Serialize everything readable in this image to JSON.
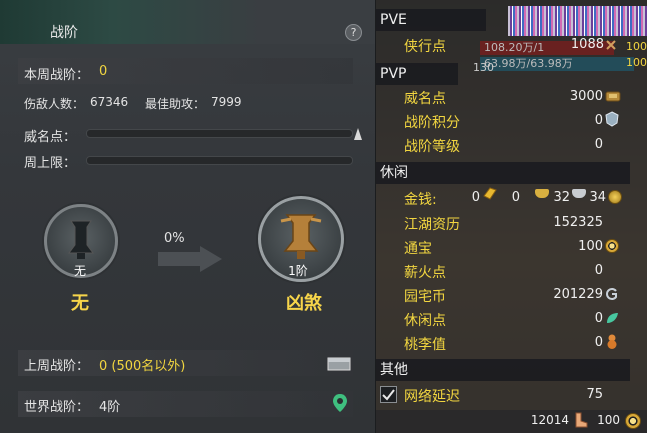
{
  "left": {
    "title": "战阶",
    "help": "?",
    "weekly_rank_label": "本周战阶：",
    "weekly_rank_value": "0",
    "kills_label": "伤敌人数：",
    "kills_value": "67346",
    "assist_label": "最佳助攻：",
    "assist_value": "7999",
    "prestige_label": "威名点：",
    "weekly_cap_label": "周上限：",
    "progress_percent": "0%",
    "current_medal_label": "无",
    "current_rank_name": "无",
    "next_medal_label": "1阶",
    "next_rank_name": "凶煞",
    "last_week_label": "上周战阶：",
    "last_week_value": "0 (500名以外)",
    "world_rank_label": "世界战阶：",
    "world_rank_value": "4阶"
  },
  "right": {
    "pve_header": "PVE",
    "chivalry_label": "侠行点",
    "chivalry_value": "1088",
    "hp_text": "108.20万/1",
    "mp_text": "63.98万/63.98万",
    "level_badge": "130",
    "edge_right_1": "100",
    "edge_right_2": "100",
    "pvp_header": "PVP",
    "prestige_label": "威名点",
    "prestige_value": "3000",
    "battle_points_label": "战阶积分",
    "battle_points_value": "0",
    "battle_level_label": "战阶等级",
    "battle_level_value": "0",
    "leisure_header": "休闲",
    "money_label": "金钱:",
    "money_gold": "0",
    "money_big": "0",
    "money_silver": "32",
    "money_copper": "34",
    "jianghu_label": "江湖资历",
    "jianghu_value": "152325",
    "tongbao_label": "通宝",
    "tongbao_value": "100",
    "firewood_label": "薪火点",
    "firewood_value": "0",
    "garden_label": "园宅币",
    "garden_value": "201229",
    "leisure_pts_label": "休闲点",
    "leisure_pts_value": "0",
    "taoli_label": "桃李值",
    "taoli_value": "0",
    "other_header": "其他",
    "latency_label": "网络延迟",
    "latency_value": "75",
    "bottom_value_1": "12014",
    "bottom_value_2": "100"
  },
  "colors": {
    "accent_yellow": "#f2d640",
    "panel_dark": "#34373b"
  }
}
